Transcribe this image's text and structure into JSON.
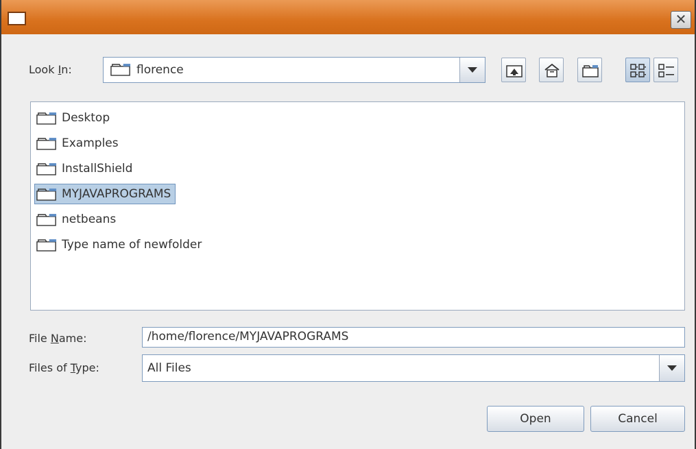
{
  "look_in": {
    "label_pre": "Look ",
    "label_mnemonic": "I",
    "label_post": "n:",
    "value": "florence"
  },
  "toolbar": {
    "up_icon": "up-one-level-icon",
    "home_icon": "home-icon",
    "new_folder_icon": "new-folder-icon",
    "list_icon": "list-view-icon",
    "details_icon": "details-view-icon"
  },
  "files": [
    {
      "name": "Desktop",
      "selected": false
    },
    {
      "name": "Examples",
      "selected": false
    },
    {
      "name": "InstallShield",
      "selected": false
    },
    {
      "name": "MYJAVAPROGRAMS",
      "selected": true
    },
    {
      "name": "netbeans",
      "selected": false
    },
    {
      "name": "Type name of newfolder",
      "selected": false
    }
  ],
  "file_name": {
    "label_pre": "File ",
    "label_mnemonic": "N",
    "label_post": "ame:",
    "value": "/home/florence/MYJAVAPROGRAMS"
  },
  "file_type": {
    "label_pre": "Files of ",
    "label_mnemonic": "T",
    "label_post": "ype:",
    "value": "All Files"
  },
  "buttons": {
    "open": "Open",
    "cancel": "Cancel"
  },
  "window": {
    "close_glyph": "✕"
  },
  "colors": {
    "titlebar": "#d9721e",
    "selection": "#b8cfe5",
    "border": "#7e9bbd"
  }
}
